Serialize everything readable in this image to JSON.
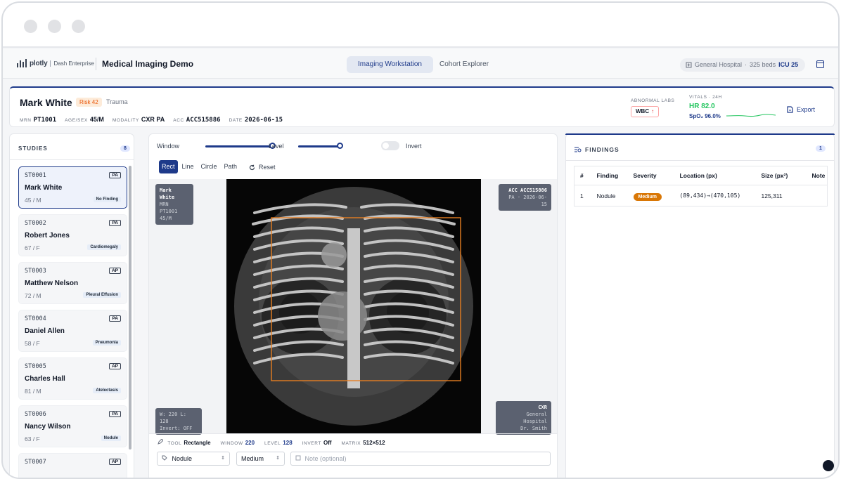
{
  "app": {
    "brand": "plotly",
    "brand_sub": "Dash Enterprise",
    "title": "Medical Imaging Demo",
    "tabs": [
      {
        "label": "Imaging Workstation",
        "active": true
      },
      {
        "label": "Cohort Explorer",
        "active": false
      }
    ],
    "hospital": {
      "name": "General Hospital",
      "sep": "·",
      "beds": "325 beds",
      "icu": "ICU 25"
    }
  },
  "patient": {
    "name": "Mark White",
    "risk": "Risk 42",
    "category": "Trauma",
    "mrn_label": "MRN",
    "mrn": "PT1001",
    "agesex_label": "AGE/SEX",
    "agesex": "45/M",
    "modality_label": "MODALITY",
    "modality": "CXR PA",
    "acc_label": "ACC",
    "acc": "ACC515886",
    "date_label": "DATE",
    "date": "2026-06-15",
    "labs_label": "ABNORMAL LABS",
    "labs": [
      {
        "name": "WBC",
        "flag": "↑"
      }
    ],
    "vitals_label": "VITALS · 24H",
    "hr": "HR 82.0",
    "spo2": "SpO₂ 96.0%",
    "export_label": "Export",
    "colors": {
      "hr": "#22c55e",
      "accent": "#1e3a8a"
    }
  },
  "studies": {
    "header": "STUDIES",
    "count": "8",
    "items": [
      {
        "id": "ST0001",
        "view": "PA",
        "name": "Mark White",
        "agesex": "45 / M",
        "finding": "No Finding",
        "selected": true
      },
      {
        "id": "ST0002",
        "view": "PA",
        "name": "Robert Jones",
        "agesex": "67 / F",
        "finding": "Cardiomegaly"
      },
      {
        "id": "ST0003",
        "view": "AP",
        "name": "Matthew Nelson",
        "agesex": "72 / M",
        "finding": "Pleural Effusion"
      },
      {
        "id": "ST0004",
        "view": "PA",
        "name": "Daniel Allen",
        "agesex": "58 / F",
        "finding": "Pneumonia"
      },
      {
        "id": "ST0005",
        "view": "AP",
        "name": "Charles Hall",
        "agesex": "81 / M",
        "finding": "Atelectasis"
      },
      {
        "id": "ST0006",
        "view": "PA",
        "name": "Nancy Wilson",
        "agesex": "63 / F",
        "finding": "Nodule"
      },
      {
        "id": "ST0007",
        "view": "AP",
        "name": "",
        "agesex": "",
        "finding": ""
      }
    ]
  },
  "viewer": {
    "window_label": "Window",
    "level_label": "Level",
    "invert_label": "Invert",
    "window_level": 0.73,
    "level_level": 0.45,
    "tools": [
      "Rect",
      "Line",
      "Circle",
      "Path"
    ],
    "active_tool": "Rect",
    "reset_label": "Reset",
    "overlay_tl": {
      "name": "Mark White",
      "mrn": "MRN PT1001",
      "agesex": "45/M"
    },
    "overlay_tr": {
      "acc": "ACC ACC515886",
      "view_date": "PA · 2026-06-15"
    },
    "overlay_bl": {
      "wl": "W: 220 L: 128",
      "invert": "Invert: OFF"
    },
    "overlay_br": {
      "modality": "CXR",
      "hospital": "General Hospital",
      "doctor": "Dr. Smith"
    },
    "status": {
      "tool_label": "TOOL",
      "tool": "Rectangle",
      "window_label": "WINDOW",
      "window": "220",
      "level_label": "LEVEL",
      "level": "128",
      "invert_label": "INVERT",
      "invert": "Off",
      "matrix_label": "MATRIX",
      "matrix": "512×512"
    },
    "finding_select": "Nodule",
    "severity_select": "Medium",
    "note_placeholder": "Note (optional)"
  },
  "findings": {
    "header": "FINDINGS",
    "count": "1",
    "columns": [
      "#",
      "Finding",
      "Severity",
      "Location (px)",
      "Size (px²)",
      "Note"
    ],
    "rows": [
      {
        "n": "1",
        "finding": "Nodule",
        "severity": "Medium",
        "location": "(89,434)→(470,105)",
        "size": "125,311",
        "note": ""
      }
    ],
    "severity_color": "#d97706"
  }
}
